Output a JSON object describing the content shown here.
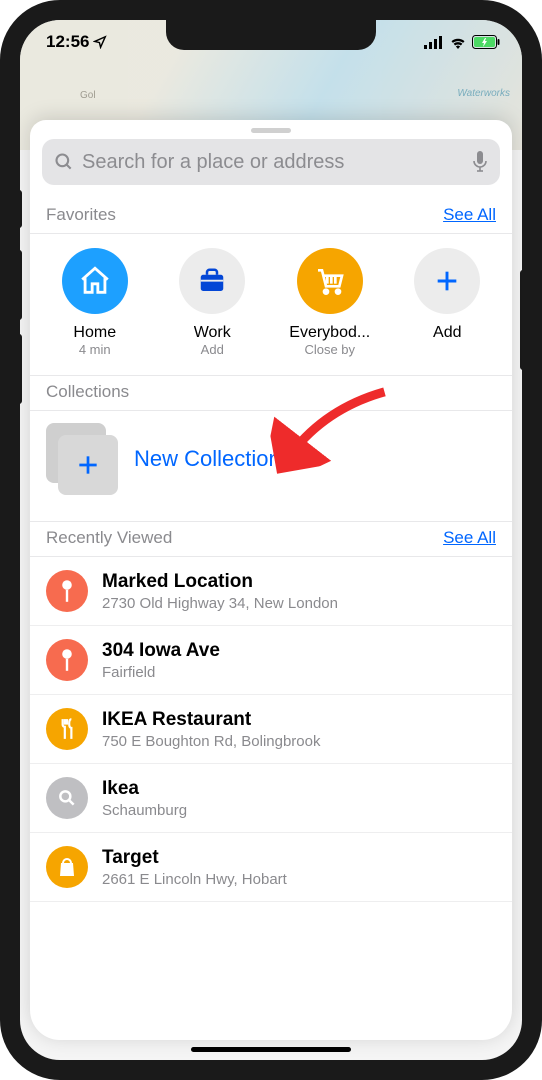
{
  "status": {
    "time": "12:56"
  },
  "map": {
    "label_gol": "Gol",
    "label_waterworks": "Waterworks"
  },
  "search": {
    "placeholder": "Search for a place or address"
  },
  "favorites": {
    "title": "Favorites",
    "see_all": "See All",
    "items": [
      {
        "label": "Home",
        "sub": "4 min",
        "color": "#1da0ff",
        "icon": "home"
      },
      {
        "label": "Work",
        "sub": "Add",
        "color": "#ececec",
        "icon": "briefcase"
      },
      {
        "label": "Everybod...",
        "sub": "Close by",
        "color": "#f6a500",
        "icon": "cart"
      },
      {
        "label": "Add",
        "sub": "",
        "color": "#ececec",
        "icon": "plus"
      }
    ]
  },
  "collections": {
    "title": "Collections",
    "new_label": "New Collection…"
  },
  "recent": {
    "title": "Recently Viewed",
    "see_all": "See All",
    "items": [
      {
        "title": "Marked Location",
        "sub": "2730 Old Highway 34, New London",
        "icon": "pin",
        "color": "#f76b4f"
      },
      {
        "title": "304 Iowa Ave",
        "sub": "Fairfield",
        "icon": "pin",
        "color": "#f76b4f"
      },
      {
        "title": "IKEA Restaurant",
        "sub": "750 E Boughton Rd, Bolingbrook",
        "icon": "fork",
        "color": "#f6a500"
      },
      {
        "title": "Ikea",
        "sub": "Schaumburg",
        "icon": "search",
        "color": "#bfbfc2"
      },
      {
        "title": "Target",
        "sub": "2661 E Lincoln Hwy, Hobart",
        "icon": "bag",
        "color": "#f6a500"
      }
    ]
  }
}
